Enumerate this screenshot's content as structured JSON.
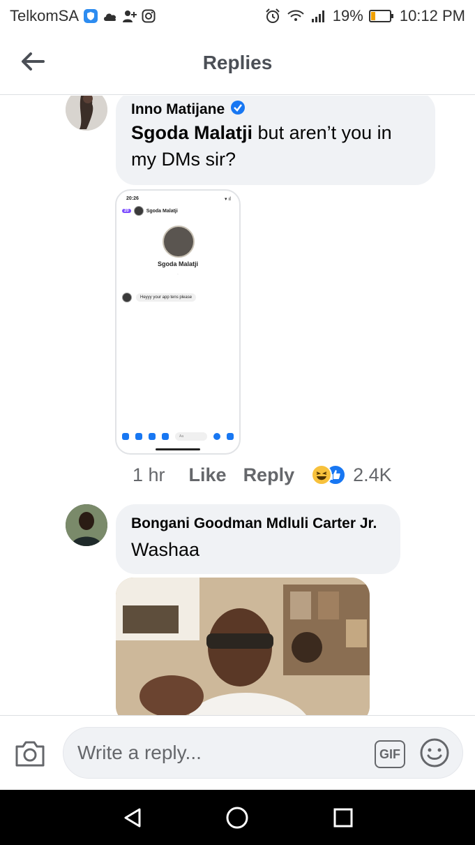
{
  "status_bar": {
    "carrier": "TelkomSA",
    "battery": "19%",
    "time": "10:12 PM"
  },
  "header": {
    "title": "Replies"
  },
  "comments": [
    {
      "author": "Inno Matijane",
      "verified": true,
      "mention": "Sgoda Malatji",
      "text": " but aren’t you in my DMs sir?",
      "time": "1 hr",
      "like_label": "Like",
      "reply_label": "Reply",
      "reaction_count": "2.4K",
      "screenshot": {
        "time": "20:26",
        "badge": "20",
        "contact": "Sgoda Malatji",
        "name": "Sgoda Malatji",
        "message": "Heyyy your app tens please",
        "input_placeholder": "Aa"
      }
    },
    {
      "author": "Bongani Goodman Mdluli Carter Jr.",
      "text": "Washaa"
    }
  ],
  "composer": {
    "placeholder": "Write a reply...",
    "gif_label": "GIF"
  },
  "colors": {
    "bubble": "#f0f2f5",
    "accent": "#1877f2",
    "muted": "#65676b"
  }
}
